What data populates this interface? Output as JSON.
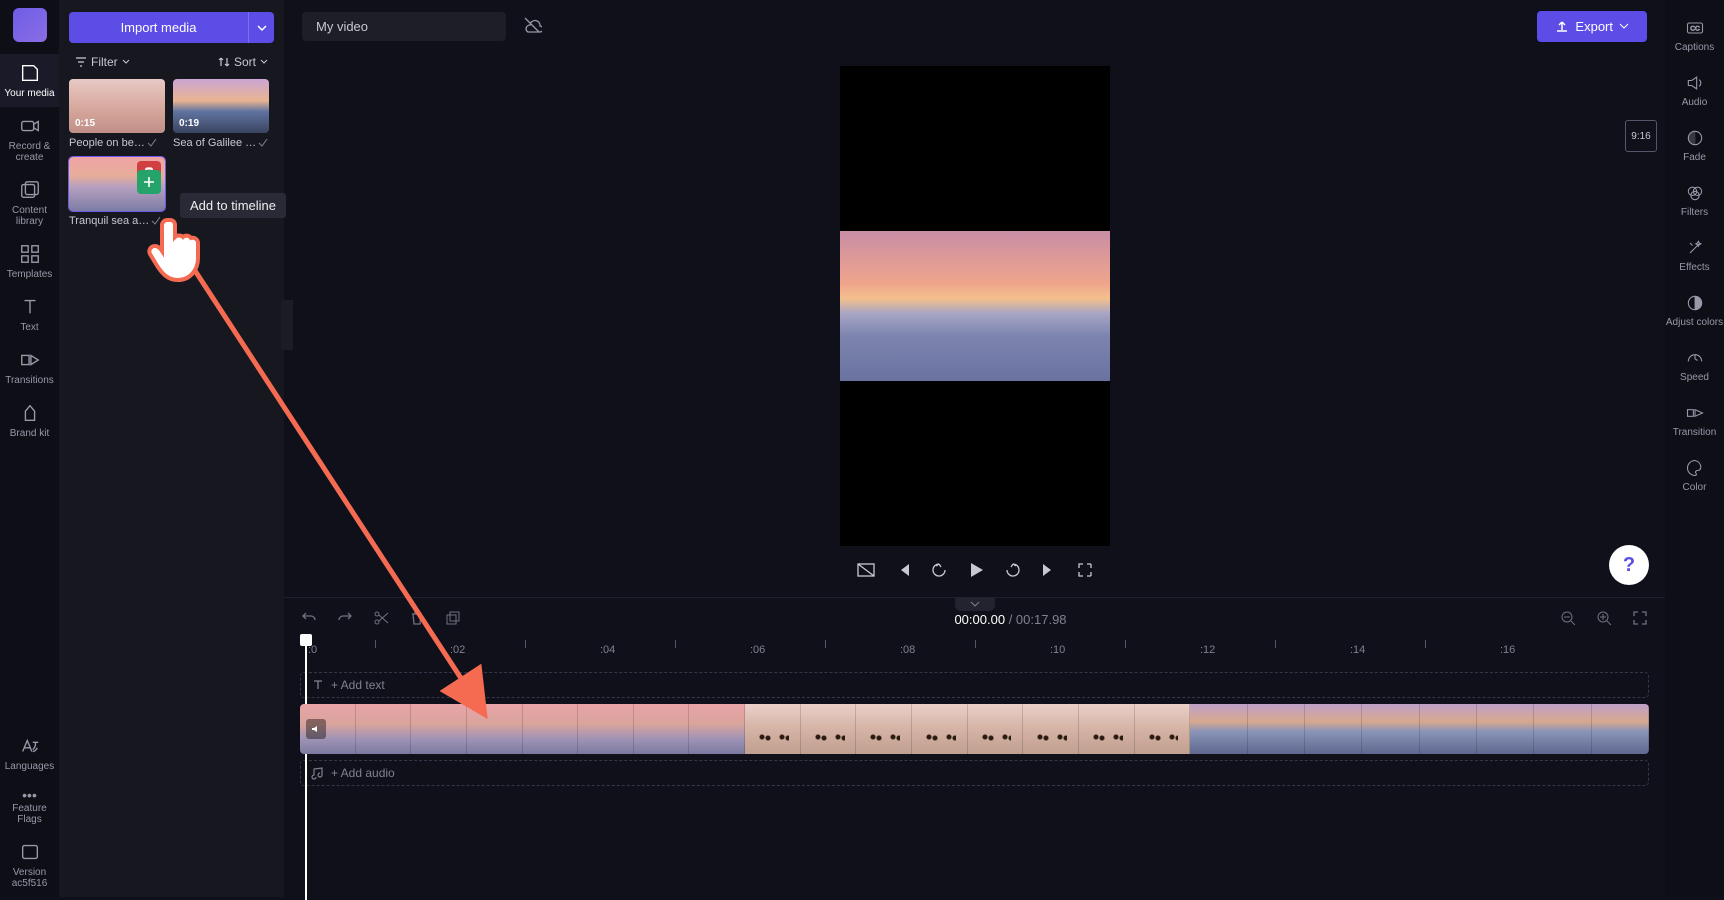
{
  "leftbar": {
    "items": [
      {
        "label": "Your media"
      },
      {
        "label": "Record & create"
      },
      {
        "label": "Content library"
      },
      {
        "label": "Templates"
      },
      {
        "label": "Text"
      },
      {
        "label": "Transitions"
      },
      {
        "label": "Brand kit"
      }
    ],
    "bottom": [
      {
        "label": "Languages"
      },
      {
        "label": "Feature Flags"
      },
      {
        "label": "Version ac5f516"
      }
    ]
  },
  "media": {
    "import_label": "Import media",
    "filter_label": "Filter",
    "sort_label": "Sort",
    "items": [
      {
        "duration": "0:15",
        "name": "People on be…"
      },
      {
        "duration": "0:19",
        "name": "Sea of Galilee …"
      },
      {
        "duration": "",
        "name": "Tranquil sea a…"
      }
    ],
    "tooltip": "Add to timeline"
  },
  "topbar": {
    "video_name": "My video",
    "export_label": "Export"
  },
  "stage": {
    "aspect": "9:16"
  },
  "rightbar": {
    "items": [
      {
        "label": "Captions"
      },
      {
        "label": "Audio"
      },
      {
        "label": "Fade"
      },
      {
        "label": "Filters"
      },
      {
        "label": "Effects"
      },
      {
        "label": "Adjust colors"
      },
      {
        "label": "Speed"
      },
      {
        "label": "Transition"
      },
      {
        "label": "Color"
      }
    ]
  },
  "timeline": {
    "current": "00:00.00",
    "total": "00:17.98",
    "ruler": [
      ":0",
      ":02",
      ":04",
      ":06",
      ":08",
      ":10",
      ":12",
      ":14",
      ":16"
    ],
    "add_text": "+ Add text",
    "add_audio": "+ Add audio"
  }
}
